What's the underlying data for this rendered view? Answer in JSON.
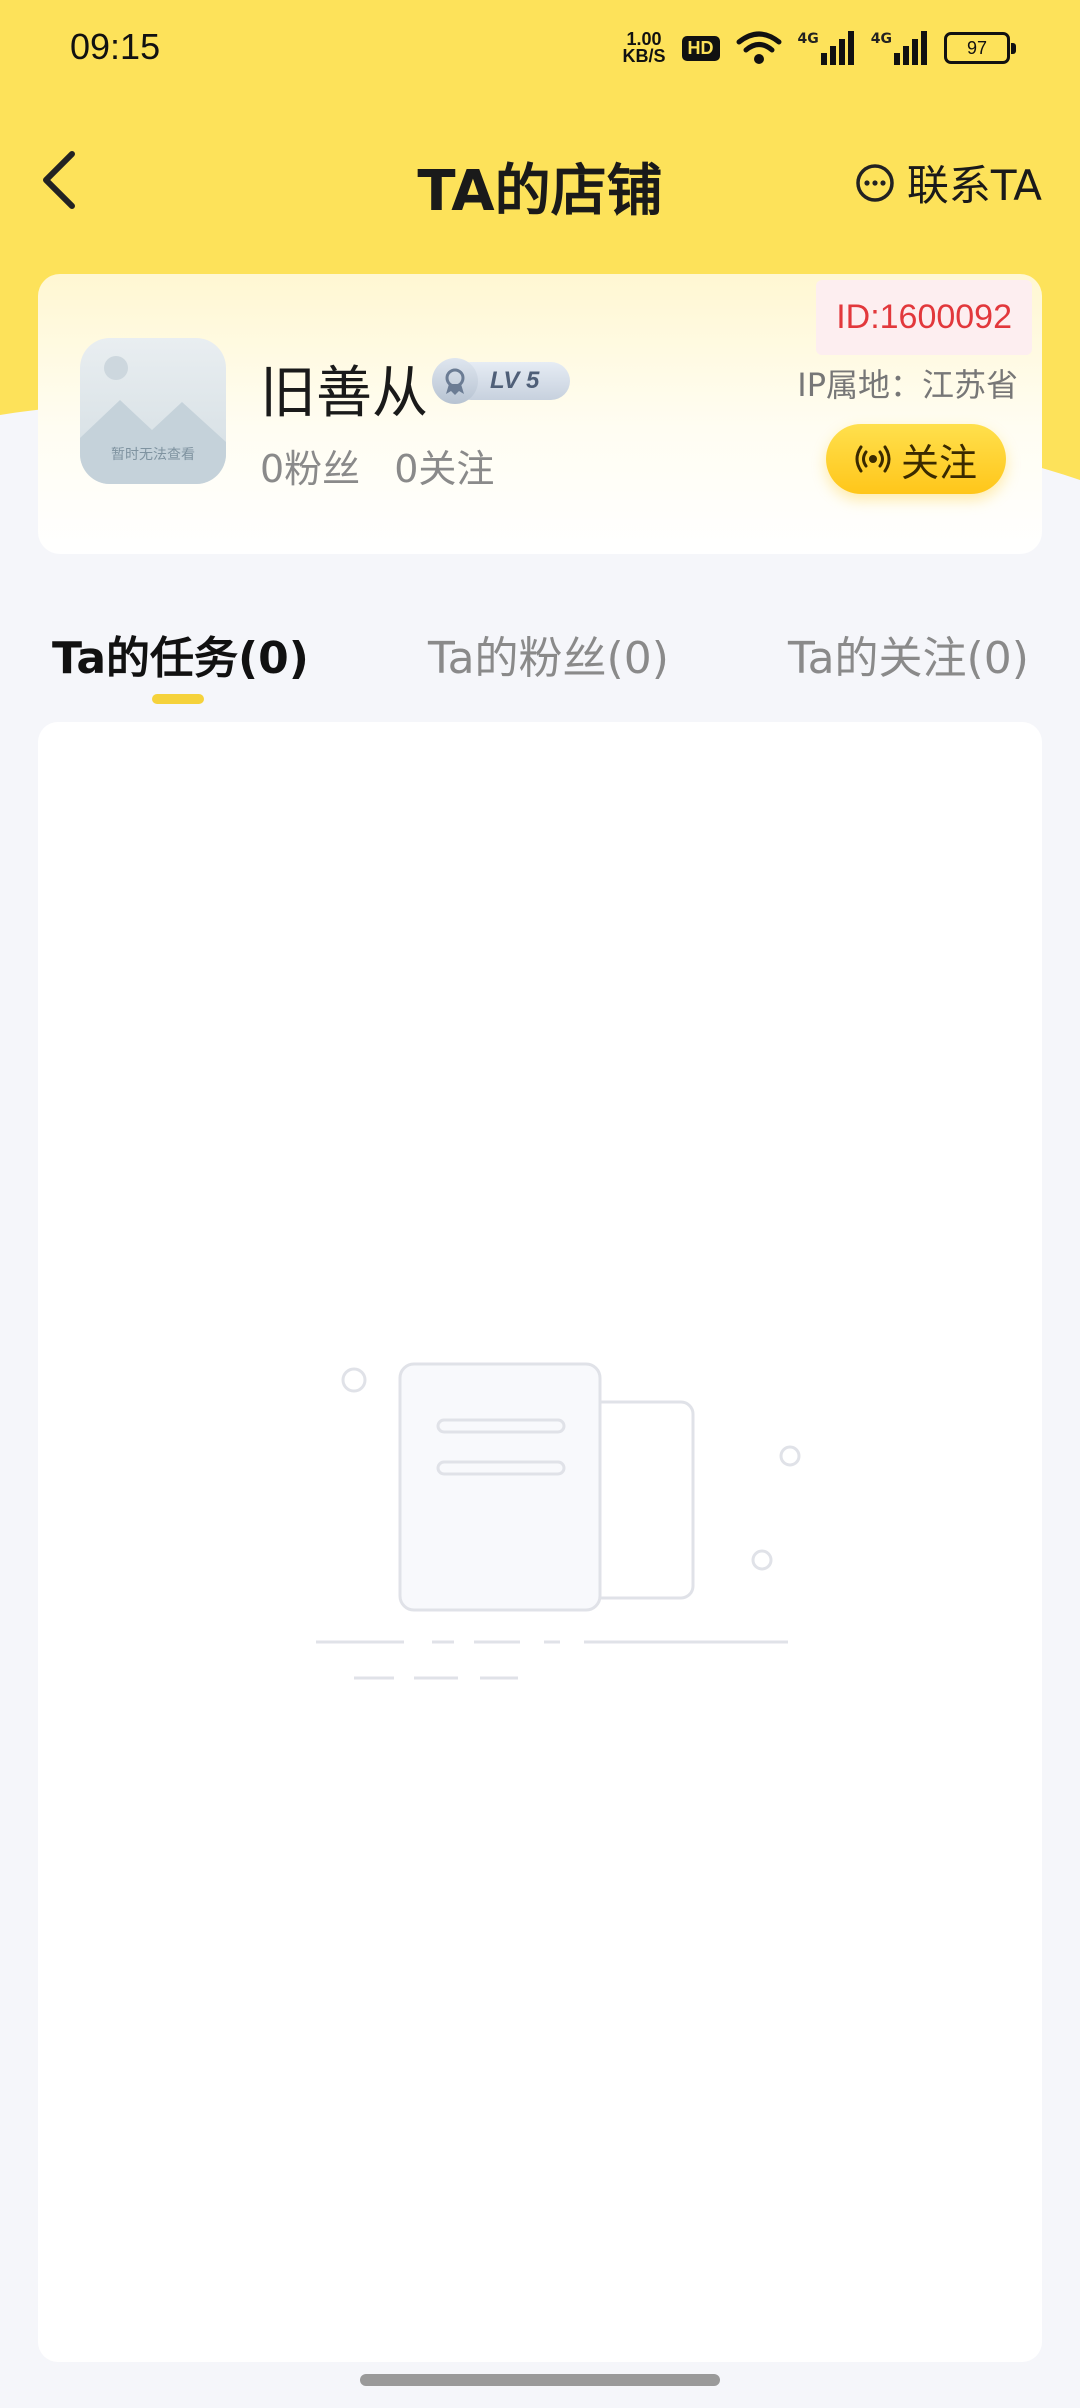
{
  "status_bar": {
    "time": "09:15",
    "net_speed_value": "1.00",
    "net_speed_unit": "KB/S",
    "hd_label": "HD",
    "signal_labels": [
      "4G",
      "4G"
    ],
    "battery": "97"
  },
  "nav": {
    "title": "TA的店铺",
    "contact_label": "联系TA"
  },
  "profile": {
    "id_label": "ID:1600092",
    "avatar_placeholder": "暂时无法查看",
    "username": "旧善从",
    "level": "LV 5",
    "fans": "0粉丝",
    "following": "0关注",
    "ip_location": "IP属地：江苏省",
    "follow_button": "关注"
  },
  "tabs": [
    {
      "label": "Ta的任务(0)",
      "active": true
    },
    {
      "label": "Ta的粉丝(0)",
      "active": false
    },
    {
      "label": "Ta的关注(0)",
      "active": false
    }
  ],
  "colors": {
    "brand_yellow": "#fde25a",
    "id_red": "#e2383c",
    "background": "#f5f6fa"
  }
}
